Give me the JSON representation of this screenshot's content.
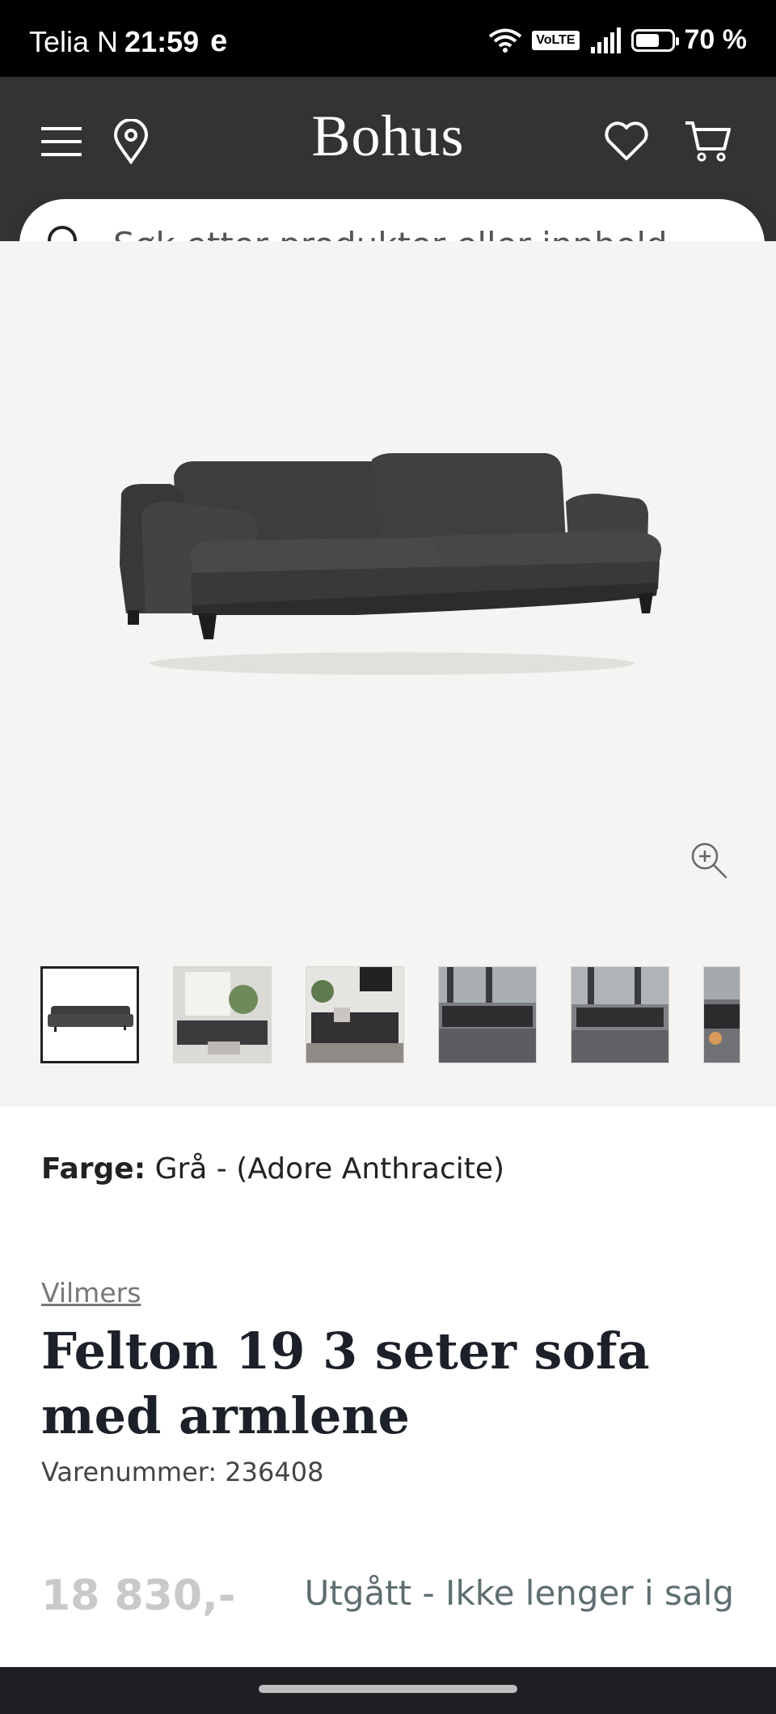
{
  "status_bar": {
    "carrier": "Telia N",
    "time": "21:59",
    "carrier_icon": "e",
    "volte": "VoLTE",
    "battery": "70 %"
  },
  "header": {
    "logo": "Bohus",
    "icons": [
      "menu-icon",
      "location-pin-icon",
      "heart-icon",
      "cart-icon"
    ]
  },
  "search": {
    "placeholder": "Søk etter produkter eller innhold ..."
  },
  "gallery": {
    "thumbnail_count_visible": 6,
    "active_thumbnail": 1
  },
  "product": {
    "color_label": "Farge:",
    "color_value": "Grå - (Adore Anthracite)",
    "brand": "Vilmers",
    "title": "Felton 19 3 seter sofa med armlene",
    "sku": "Varenummer: 236408",
    "price": "18 830,-",
    "availability": "Utgått - Ikke lenger i salg"
  },
  "colors": {
    "header_bg": "#323335",
    "gallery_bg": "#f5f4f2",
    "title": "#1c2029",
    "price_disabled": "#c9c9c9",
    "status_text": "#5e6e70"
  }
}
